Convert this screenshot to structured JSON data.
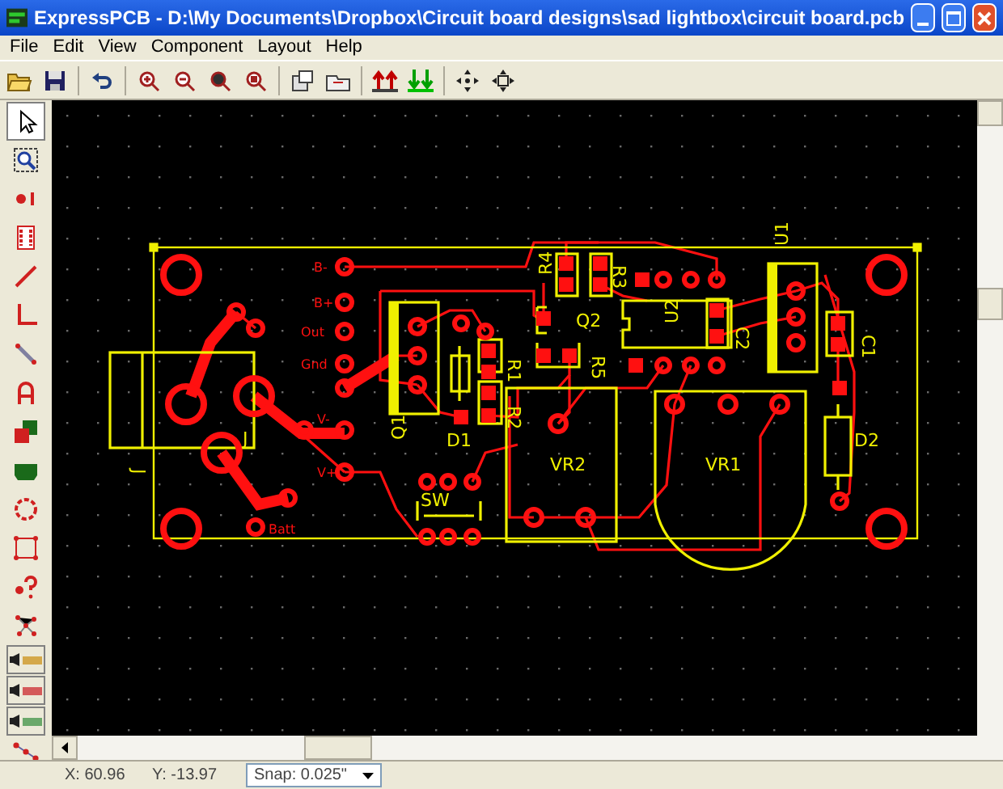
{
  "window": {
    "title": "ExpressPCB - D:\\My Documents\\Dropbox\\Circuit board designs\\sad lightbox\\circuit board.pcb"
  },
  "menu": [
    "File",
    "Edit",
    "View",
    "Component",
    "Layout",
    "Help"
  ],
  "tools": [
    {
      "kind": "pointer",
      "selected": true
    },
    {
      "kind": "zoom-window",
      "selected": false
    },
    {
      "kind": "pad",
      "selected": false
    },
    {
      "kind": "component",
      "selected": false
    },
    {
      "kind": "trace",
      "selected": false
    },
    {
      "kind": "corner",
      "selected": false
    },
    {
      "kind": "line",
      "selected": false
    },
    {
      "kind": "text",
      "selected": false
    },
    {
      "kind": "layers",
      "selected": false
    },
    {
      "kind": "board",
      "selected": false
    },
    {
      "kind": "circle",
      "selected": false
    },
    {
      "kind": "rectangle",
      "selected": false
    },
    {
      "kind": "query",
      "selected": false
    },
    {
      "kind": "net",
      "selected": false
    }
  ],
  "layer_tools": [
    {
      "color": "#d4a84a"
    },
    {
      "color": "#d45a5a"
    },
    {
      "color": "#6aa86a"
    }
  ],
  "board_labels": [
    {
      "text": "U1",
      "color": "#f0f000"
    },
    {
      "text": "R4",
      "color": "#f0f000"
    },
    {
      "text": "R3",
      "color": "#f0f000"
    },
    {
      "text": "B-",
      "color": "#ff1010"
    },
    {
      "text": "B+",
      "color": "#ff1010"
    },
    {
      "text": "U2",
      "color": "#f0f000"
    },
    {
      "text": "Q2",
      "color": "#f0f000"
    },
    {
      "text": "C2",
      "color": "#f0f000"
    },
    {
      "text": "C1",
      "color": "#f0f000"
    },
    {
      "text": "Out",
      "color": "#ff1010"
    },
    {
      "text": "R5",
      "color": "#f0f000"
    },
    {
      "text": "R1",
      "color": "#f0f000"
    },
    {
      "text": "Gnd",
      "color": "#ff1010"
    },
    {
      "text": "R2",
      "color": "#f0f000"
    },
    {
      "text": "V-",
      "color": "#ff1010"
    },
    {
      "text": "Q1",
      "color": "#f0f000"
    },
    {
      "text": "J",
      "color": "#f0f000"
    },
    {
      "text": "D1",
      "color": "#f0f000"
    },
    {
      "text": "D2",
      "color": "#f0f000"
    },
    {
      "text": "J",
      "color": "#f0f000"
    },
    {
      "text": "V+",
      "color": "#ff1010"
    },
    {
      "text": "VR2",
      "color": "#f0f000"
    },
    {
      "text": "VR1",
      "color": "#f0f000"
    },
    {
      "text": "SW",
      "color": "#f0f000"
    },
    {
      "text": "Batt",
      "color": "#ff1010"
    }
  ],
  "status_bar": {
    "x": "X: 60.96",
    "y": "Y: -13.97",
    "snap": "Snap: 0.025\""
  }
}
